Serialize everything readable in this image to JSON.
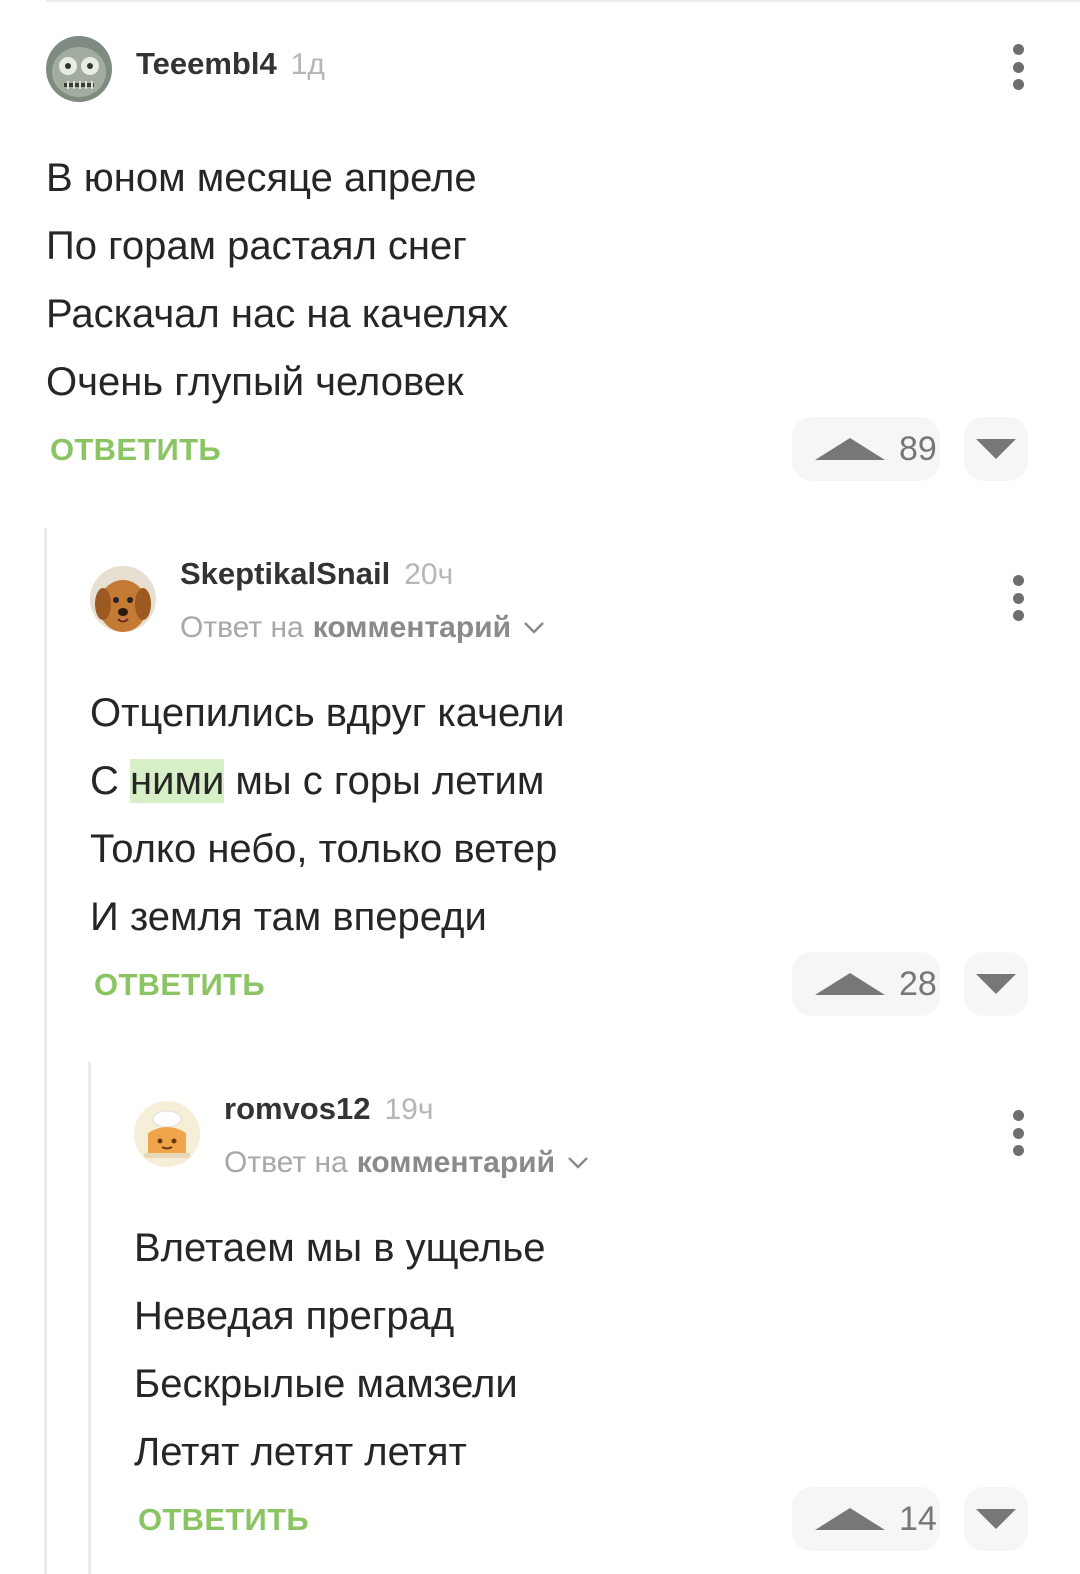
{
  "comments": [
    {
      "username": "Teeembl4",
      "time": "1д",
      "lines": [
        "В юном месяце апреле",
        "По горам растаял снег",
        "Раскачал нас на качелях",
        "Очень глупый человек"
      ],
      "reply_label": "ОТВЕТИТЬ",
      "votes": "89"
    },
    {
      "username": "SkeptikalSnail",
      "time": "20ч",
      "reply_to_prefix": "Ответ на",
      "reply_to_link": "комментарий",
      "line1": "Отцепились вдруг качели",
      "line2_before": "С",
      "line2_highlight": "ними",
      "line2_after": "мы с горы летим",
      "line3": "Толко небо, только ветер",
      "line4": "И земля там впереди",
      "reply_label": "ОТВЕТИТЬ",
      "votes": "28"
    },
    {
      "username": "romvos12",
      "time": "19ч",
      "reply_to_prefix": "Ответ на",
      "reply_to_link": "комментарий",
      "lines": [
        "Влетаем мы в ущелье",
        "Неведая преград",
        "Бескрылые мамзели",
        "Летят летят летят"
      ],
      "reply_label": "ОТВЕТИТЬ",
      "votes": "14"
    }
  ],
  "colors": {
    "accent": "#8ac463",
    "highlight": "#d7efc7",
    "vote_icon": "#777777"
  },
  "icons": [
    "more-vertical-icon",
    "chevron-down-icon",
    "upvote-triangle-icon",
    "downvote-triangle-icon"
  ]
}
